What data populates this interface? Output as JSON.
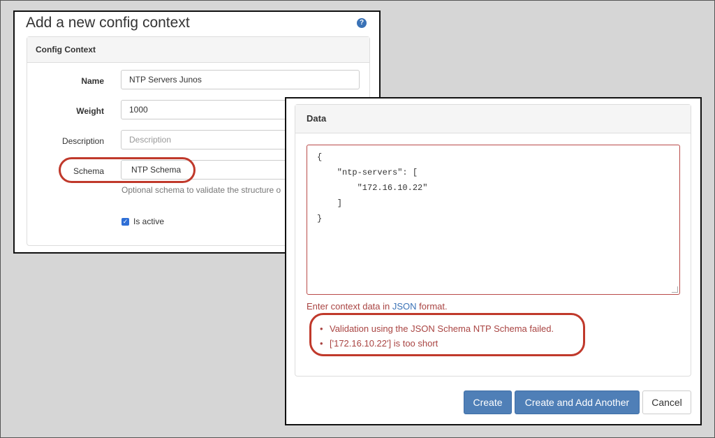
{
  "left_window": {
    "title": "Add a new config context",
    "help_icon": "question-circle-icon",
    "panel_title": "Config Context",
    "fields": {
      "name": {
        "label": "Name",
        "value": "NTP Servers Junos"
      },
      "weight": {
        "label": "Weight",
        "value": "1000"
      },
      "description": {
        "label": "Description",
        "placeholder": "Description"
      },
      "schema": {
        "label": "Schema",
        "value": "NTP Schema",
        "help": "Optional schema to validate the structure o"
      },
      "is_active": {
        "label": "Is active",
        "checked": true
      }
    }
  },
  "right_window": {
    "panel_title": "Data",
    "code_lines": [
      "{",
      "    \"ntp-servers\": [",
      "        \"172.16.10.22\"",
      "    ]",
      "}"
    ],
    "help_prefix": "Enter context data in ",
    "help_link": "JSON",
    "help_suffix": " format.",
    "errors": [
      "Validation using the JSON Schema NTP Schema failed.",
      "['172.16.10.22'] is too short"
    ],
    "buttons": {
      "create": "Create",
      "create_another": "Create and Add Another",
      "cancel": "Cancel"
    }
  },
  "colors": {
    "highlight_oval": "#c0392b",
    "error_text": "#a94442",
    "primary_button": "#4f7fb7",
    "link": "#3a72b6"
  }
}
